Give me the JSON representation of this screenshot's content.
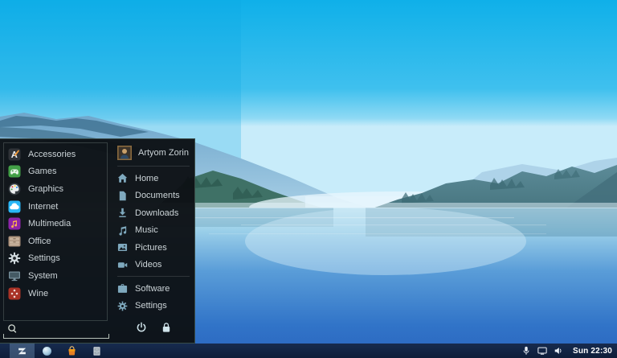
{
  "menu": {
    "categories": [
      {
        "label": "Accessories",
        "icon": "accessories"
      },
      {
        "label": "Games",
        "icon": "games"
      },
      {
        "label": "Graphics",
        "icon": "graphics"
      },
      {
        "label": "Internet",
        "icon": "internet"
      },
      {
        "label": "Multimedia",
        "icon": "multimedia"
      },
      {
        "label": "Office",
        "icon": "office"
      },
      {
        "label": "Settings",
        "icon": "settings-category"
      },
      {
        "label": "System",
        "icon": "system"
      },
      {
        "label": "Wine",
        "icon": "wine"
      }
    ],
    "user_name": "Artyom Zorin",
    "places": [
      {
        "label": "Home",
        "icon": "home"
      },
      {
        "label": "Documents",
        "icon": "document"
      },
      {
        "label": "Downloads",
        "icon": "download"
      },
      {
        "label": "Music",
        "icon": "music"
      },
      {
        "label": "Pictures",
        "icon": "picture"
      },
      {
        "label": "Videos",
        "icon": "video"
      }
    ],
    "shortcuts": [
      {
        "label": "Software",
        "icon": "briefcase"
      },
      {
        "label": "Settings",
        "icon": "gear"
      }
    ],
    "search_placeholder": "",
    "session_buttons": [
      {
        "name": "power",
        "icon": "power"
      },
      {
        "name": "lock",
        "icon": "lock"
      }
    ]
  },
  "taskbar": {
    "launchers": [
      {
        "name": "zorin-menu",
        "icon": "zorin",
        "active": true
      },
      {
        "name": "browser",
        "icon": "browser",
        "active": false
      },
      {
        "name": "software-store",
        "icon": "software-bag",
        "active": false
      },
      {
        "name": "file-manager",
        "icon": "file-cabinet",
        "active": false
      }
    ],
    "tray": [
      {
        "name": "microphone",
        "icon": "microphone"
      },
      {
        "name": "display",
        "icon": "display"
      },
      {
        "name": "volume",
        "icon": "volume"
      }
    ],
    "clock": "Sun 22:30"
  },
  "colors": {
    "sky_top": "#0fb0e9",
    "water_deep": "#2b66bf",
    "menu_background": "#0d1216",
    "taskbar_background": "#14264a",
    "place_icon": "#7fa9be"
  }
}
